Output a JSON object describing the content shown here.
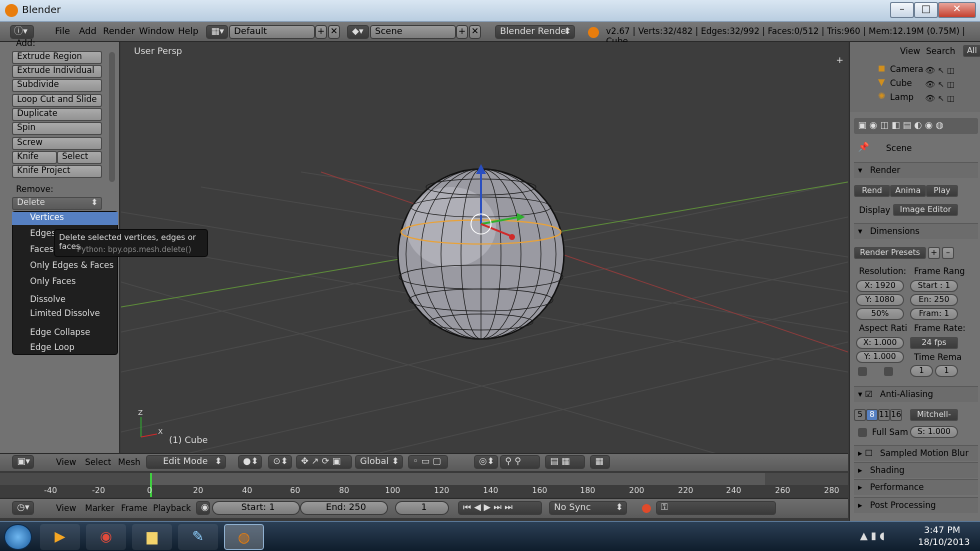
{
  "window": {
    "title": "Blender",
    "minimize": "–",
    "maximize": "□",
    "close": "✕"
  },
  "info": {
    "menus": [
      "File",
      "Add",
      "Render",
      "Window",
      "Help"
    ],
    "layout": "Default",
    "scene": "Scene",
    "engine": "Blender Render",
    "stats": "v2.67 | Verts:32/482 | Edges:32/992 | Faces:0/512 | Tris:960 | Mem:12.19M (0.75M) | Cube"
  },
  "left": {
    "add_label": "Add:",
    "buttons": [
      "Extrude Region",
      "Extrude Individual",
      "Subdivide",
      "Loop Cut and Slide",
      "Duplicate",
      "Spin",
      "Screw"
    ],
    "knife": "Knife",
    "select": "Select",
    "knife_project": "Knife Project",
    "remove_label": "Remove:",
    "delete": "Delete"
  },
  "menu": {
    "items": [
      "Vertices",
      "Edges",
      "Faces",
      "Only Edges & Faces",
      "Only Faces",
      "Dissolve",
      "Limited Dissolve",
      "Edge Collapse",
      "Edge Loop"
    ]
  },
  "tooltip": {
    "line1": "Delete selected vertices, edges or faces",
    "line2": "Python: bpy.ops.mesh.delete()"
  },
  "viewport": {
    "persp": "User Persp",
    "object": "(1) Cube",
    "axis_z": "Z",
    "axis_x": "X"
  },
  "header3d": {
    "view": "View",
    "select": "Select",
    "mesh": "Mesh",
    "mode": "Edit Mode",
    "orientation": "Global"
  },
  "timeline": {
    "ticks": [
      "-40",
      "-20",
      "0",
      "20",
      "40",
      "60",
      "80",
      "100",
      "120",
      "140",
      "160",
      "180",
      "200",
      "220",
      "240",
      "260",
      "280"
    ]
  },
  "footer": {
    "view": "View",
    "marker": "Marker",
    "frame": "Frame",
    "playback": "Playback",
    "start": "Start: 1",
    "end": "End: 250",
    "current": "1",
    "sync": "No Sync"
  },
  "outliner": {
    "view": "View",
    "search": "Search",
    "all": "All",
    "items": [
      "Camera",
      "Cube",
      "Lamp"
    ]
  },
  "props": {
    "scene": "Scene",
    "render": "Render",
    "render_btn": "Rend",
    "anim_btn": "Anima",
    "play_btn": "Play",
    "display": "Display",
    "display_val": "Image Editor",
    "dimensions": "Dimensions",
    "presets": "Render Presets",
    "resolution": "Resolution:",
    "res_x": "X: 1920",
    "res_y": "Y: 1080",
    "res_pct": "50%",
    "frame_range": "Frame Rang",
    "start": "Start : 1",
    "end": "En: 250",
    "fram": "Fram: 1",
    "aspect": "Aspect Rati",
    "asp_x": "X: 1.000",
    "asp_y": "Y: 1.000",
    "frame_rate": "Frame Rate:",
    "fps": "24 fps",
    "time_rema": "Time Rema",
    "tr1": "1",
    "tr2": "1",
    "aa": "Anti-Aliasing",
    "aa_nums": [
      "5",
      "8",
      "11",
      "16"
    ],
    "aa_filter": "Mitchell-",
    "full_sam": "Full Sam",
    "size": "S: 1.000",
    "motion_blur": "Sampled Motion Blur",
    "shading": "Shading",
    "performance": "Performance",
    "post_processing": "Post Processing"
  },
  "taskbar": {
    "time": "3:47 PM",
    "date": "18/10/2013"
  }
}
